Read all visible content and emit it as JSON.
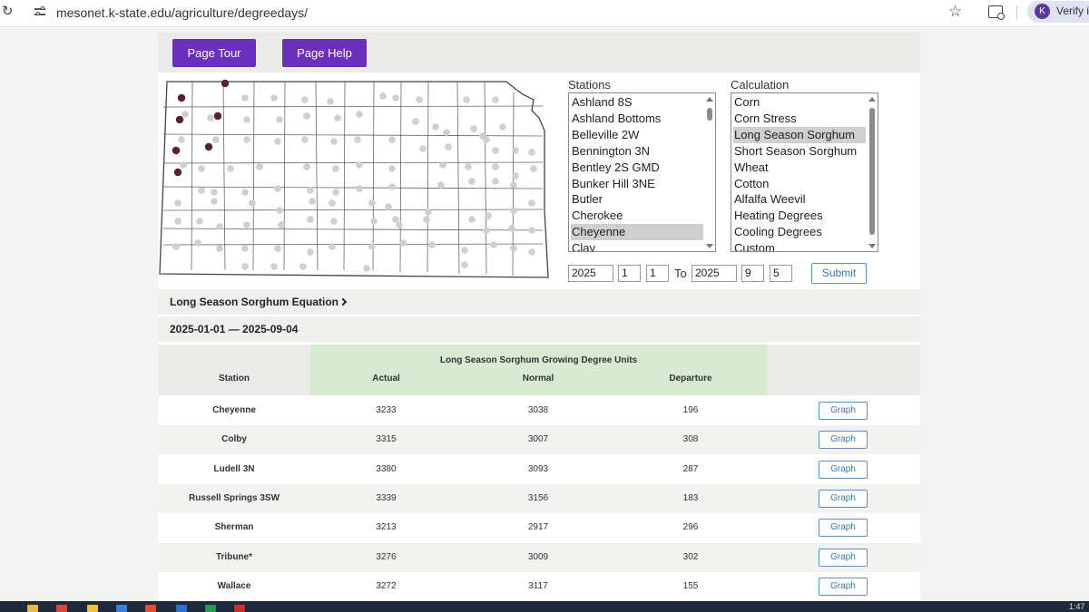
{
  "browser": {
    "url": "mesonet.k-state.edu/agriculture/degreedays/",
    "profile_initial": "K",
    "profile_label": "Verify it"
  },
  "header": {
    "tour_label": "Page Tour",
    "help_label": "Page Help"
  },
  "stations": {
    "label": "Stations",
    "options": [
      "Ashland 8S",
      "Ashland Bottoms",
      "Belleville 2W",
      "Bennington 3N",
      "Bentley 2S GMD",
      "Bunker Hill 3NE",
      "Butler",
      "Cherokee",
      "Cheyenne",
      "Clay"
    ],
    "selected": "Cheyenne"
  },
  "calculation": {
    "label": "Calculation",
    "options": [
      "Corn",
      "Corn Stress",
      "Long Season Sorghum",
      "Short Season Sorghum",
      "Wheat",
      "Cotton",
      "Alfalfa Weevil",
      "Heating Degrees",
      "Cooling Degrees",
      "Custom"
    ],
    "selected": "Long Season Sorghum"
  },
  "dates": {
    "start_year": "2025",
    "start_month": "1",
    "start_day": "1",
    "to_label": "To",
    "end_year": "2025",
    "end_month": "9",
    "end_day": "5",
    "submit_label": "Submit"
  },
  "equation_label": "Long Season Sorghum Equation",
  "range_label": "2025-01-01 — 2025-09-04",
  "table": {
    "group_header": "Long Season Sorghum Growing Degree Units",
    "col_station": "Station",
    "col_actual": "Actual",
    "col_normal": "Normal",
    "col_departure": "Departure",
    "graph_label": "Graph",
    "rows": [
      {
        "station": "Cheyenne",
        "actual": "3233",
        "normal": "3038",
        "departure": "196"
      },
      {
        "station": "Colby",
        "actual": "3315",
        "normal": "3007",
        "departure": "308"
      },
      {
        "station": "Ludell 3N",
        "actual": "3380",
        "normal": "3093",
        "departure": "287"
      },
      {
        "station": "Russell Springs 3SW",
        "actual": "3339",
        "normal": "3156",
        "departure": "183"
      },
      {
        "station": "Sherman",
        "actual": "3213",
        "normal": "2917",
        "departure": "296"
      },
      {
        "station": "Tribune*",
        "actual": "3276",
        "normal": "3009",
        "departure": "302"
      },
      {
        "station": "Wallace",
        "actual": "3272",
        "normal": "3117",
        "departure": "155"
      }
    ]
  },
  "taskbar": {
    "time": "1:47"
  },
  "colors": {
    "purple": "#6b2fbe",
    "selected_station_dot": "#5a1f3c",
    "station_dot": "#cfcfcf",
    "equation_header_green": "#d9ead3",
    "link_blue": "#3e76b9"
  }
}
